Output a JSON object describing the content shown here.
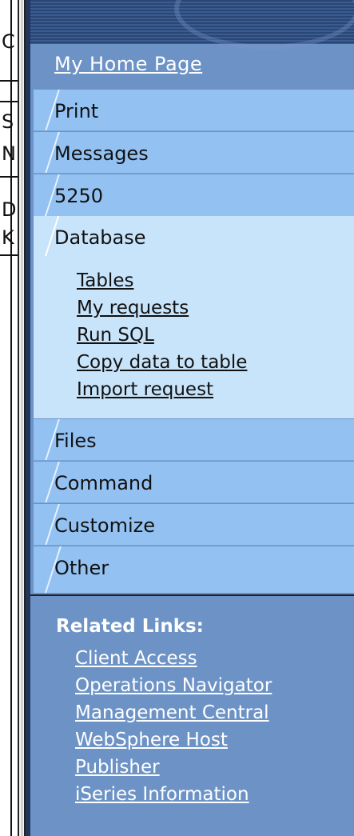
{
  "left_strip": {
    "fragments": [
      "C",
      "S",
      "N",
      "D",
      "K"
    ]
  },
  "nav": {
    "home_label": "My Home Page",
    "tabs_top": [
      {
        "label": "Print"
      },
      {
        "label": "Messages"
      },
      {
        "label": "5250"
      }
    ],
    "expanded": {
      "label": "Database",
      "links": [
        "Tables",
        "My requests",
        "Run SQL",
        "Copy data to table",
        "Import request"
      ]
    },
    "tabs_bottom": [
      {
        "label": "Files"
      },
      {
        "label": "Command"
      },
      {
        "label": "Customize"
      },
      {
        "label": "Other"
      }
    ]
  },
  "related": {
    "title": "Related Links:",
    "links": [
      "Client Access",
      "Operations Navigator",
      "Management Central",
      "WebSphere Host",
      "Publisher",
      "iSeries Information"
    ]
  },
  "colors": {
    "panel": "#6d93c6",
    "tab": "#93c2f2",
    "expanded_tab": "#c8e4fb",
    "header": "#2b4675"
  }
}
